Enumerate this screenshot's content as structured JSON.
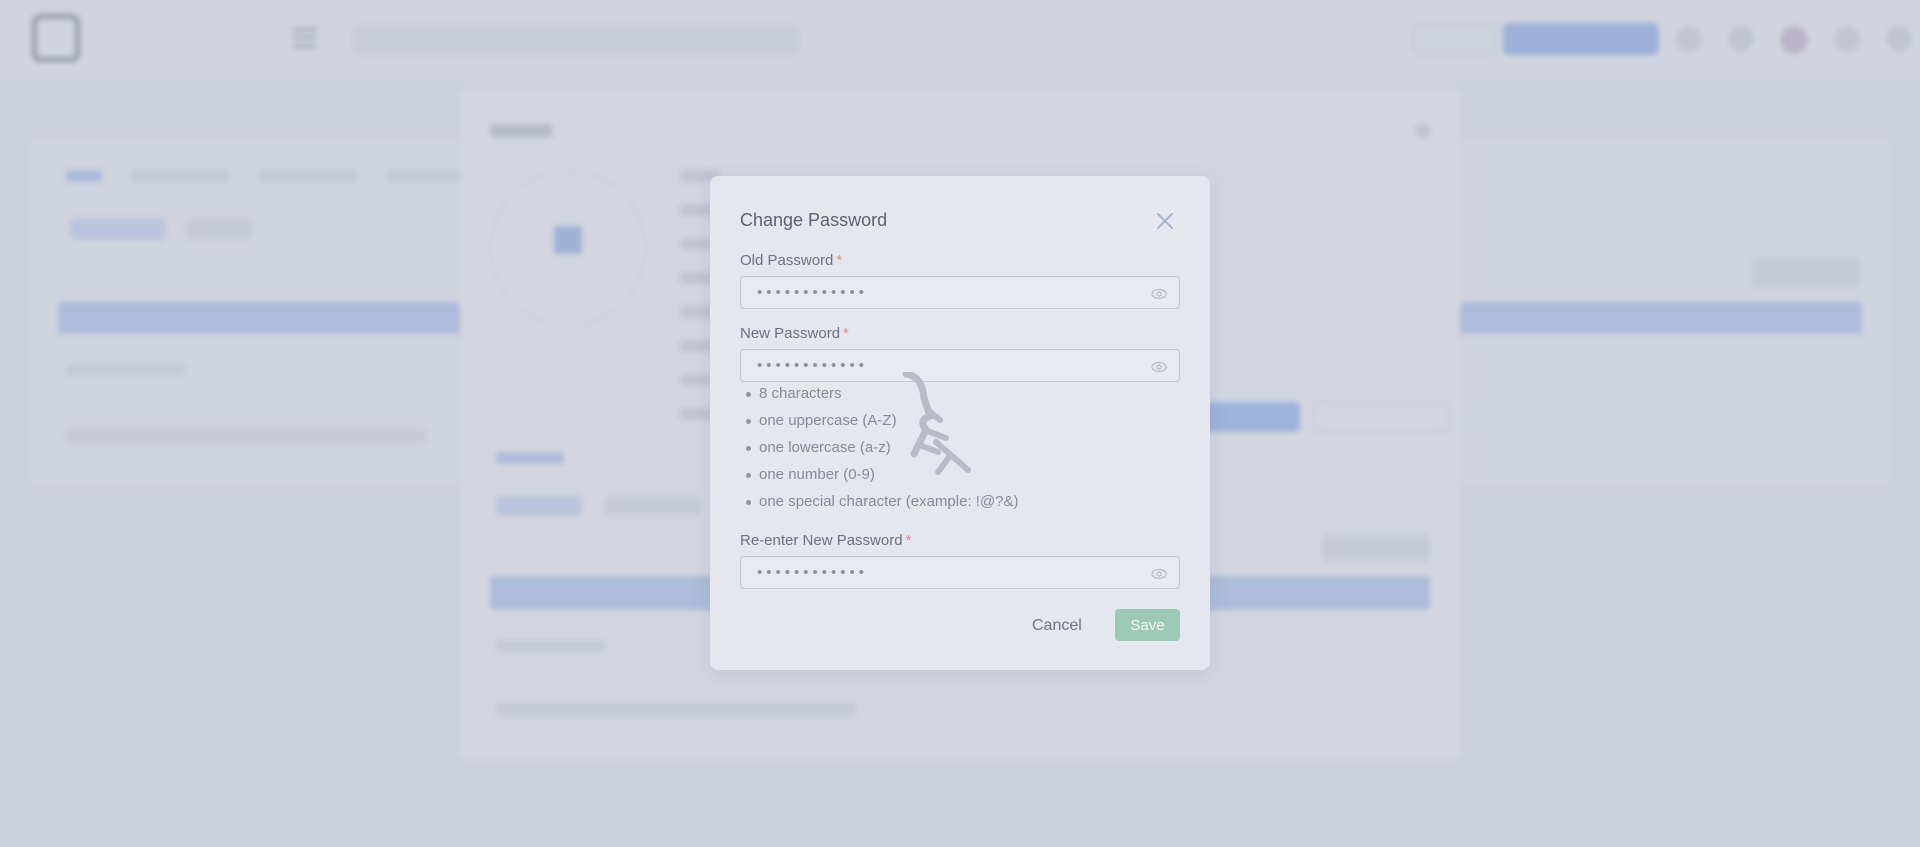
{
  "dialog": {
    "title": "Change Password",
    "old_password": {
      "label": "Old Password",
      "required_mark": "*",
      "value": "••••••••••••"
    },
    "new_password": {
      "label": "New Password",
      "required_mark": "*",
      "value": "••••••••••••"
    },
    "rules": [
      "8 characters",
      "one uppercase (A-Z)",
      "one lowercase (a-z)",
      "one number (0-9)",
      "one special character (example: !@?&)"
    ],
    "reenter_password": {
      "label": "Re-enter New Password",
      "required_mark": "*",
      "value": "••••••••••••"
    },
    "cancel_label": "Cancel",
    "save_label": "Save"
  },
  "colors": {
    "primary": "#99b7ef",
    "save": "#9cc8b6",
    "required": "#e08a8a"
  },
  "icons": {
    "close": "close-icon",
    "eye": "eye-icon",
    "menu": "menu-icon",
    "loading": "loading-icon"
  }
}
